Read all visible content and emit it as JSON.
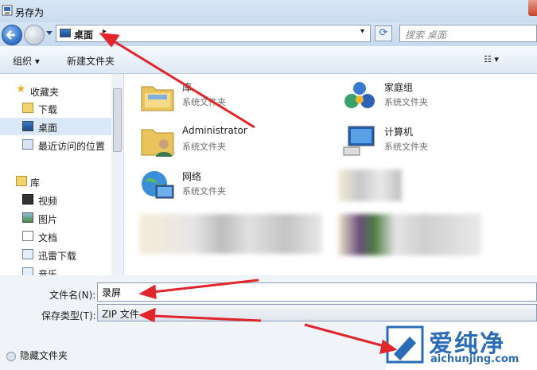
{
  "window": {
    "title": "另存为"
  },
  "address": {
    "current": "桌面",
    "separator": "▸",
    "dropdown": "▾",
    "refresh": "⟳",
    "search_placeholder": "搜索 桌面"
  },
  "toolbar": {
    "organize": "组织 ▾",
    "new_folder": "新建文件夹",
    "view": "☷ ▾"
  },
  "sidebar": {
    "items": [
      {
        "label": "收藏夹",
        "icon": "star-icon",
        "selected": false
      },
      {
        "label": "下载",
        "icon": "download-folder-icon",
        "selected": false
      },
      {
        "label": "桌面",
        "icon": "desktop-icon",
        "selected": true
      },
      {
        "label": "最近访问的位置",
        "icon": "recent-places-icon",
        "selected": false
      },
      {
        "label": "库",
        "icon": "library-icon",
        "selected": false
      },
      {
        "label": "视频",
        "icon": "video-icon",
        "selected": false
      },
      {
        "label": "图片",
        "icon": "picture-icon",
        "selected": false
      },
      {
        "label": "文档",
        "icon": "document-icon",
        "selected": false
      },
      {
        "label": "迅雷下载",
        "icon": "thunder-download-icon",
        "selected": false
      },
      {
        "label": "音乐",
        "icon": "music-icon",
        "selected": false
      }
    ]
  },
  "files": [
    {
      "name": "库",
      "desc": "系统文件夹",
      "icon": "library-folder-icon"
    },
    {
      "name": "家庭组",
      "desc": "系统文件夹",
      "icon": "homegroup-icon"
    },
    {
      "name": "Administrator",
      "desc": "系统文件夹",
      "icon": "user-folder-icon"
    },
    {
      "name": "计算机",
      "desc": "系统文件夹",
      "icon": "computer-icon"
    },
    {
      "name": "网络",
      "desc": "系统文件夹",
      "icon": "network-icon"
    }
  ],
  "form": {
    "filename_label": "文件名(N):",
    "filename_value": "录屏",
    "filetype_label": "保存类型(T):",
    "filetype_value": "ZIP 文件",
    "hide_folders": "隐藏文件夹"
  },
  "watermark": {
    "big": "爱纯净",
    "small": "aichunjing.com"
  },
  "colors": {
    "accent": "#2c6cc4",
    "arrow": "#e0262b",
    "selection": "#dbe8f7"
  }
}
